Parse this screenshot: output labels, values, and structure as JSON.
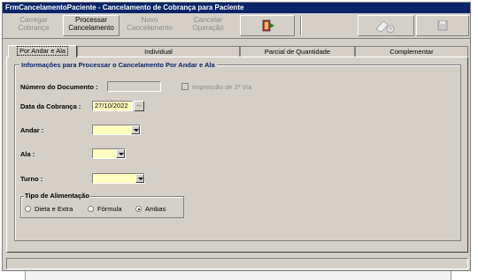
{
  "window": {
    "title": "FrmCancelamentoPaciente - Cancelamento de Cobrança para Paciente"
  },
  "toolbar": {
    "buttons": [
      {
        "line1": "Carregar",
        "line2": "Cobrança",
        "enabled": false
      },
      {
        "line1": "Processar",
        "line2": "Cancelamento",
        "enabled": true
      },
      {
        "line1": "Novo",
        "line2": "Cancelamento",
        "enabled": false
      },
      {
        "line1": "Cancelar",
        "line2": "Operação",
        "enabled": false
      }
    ],
    "icons": [
      "exit-door-icon",
      "help-icon",
      "save-disk-icon"
    ]
  },
  "tabs": [
    {
      "label": "Por Andar e Ala",
      "active": true
    },
    {
      "label": "Individual",
      "active": false
    },
    {
      "label": "Parcial de Quantidade",
      "active": false
    },
    {
      "label": "Complementar",
      "active": false
    }
  ],
  "form": {
    "group_title": "Informações para Processar o Cancelamento Por Andar e Ala",
    "documento_label": "Número do Documento :",
    "documento_value": "",
    "segunda_via_label": "Impressão de 2ª Via",
    "segunda_via_checked": false,
    "data_label": "Data da Cobrança :",
    "data_value": "27/10/2022",
    "data_button": "...",
    "andar_label": "Andar :",
    "andar_value": "",
    "ala_label": "Ala :",
    "ala_value": "",
    "turno_label": "Turno :",
    "turno_value": "",
    "alimentacao": {
      "title": "Tipo de Alimentação",
      "options": [
        "Dieta e Extra",
        "Fórmula",
        "Ambas"
      ],
      "selected": "Ambas"
    }
  },
  "colors": {
    "titlebar": "#0a246a",
    "face": "#d4d0c8",
    "required_field": "#ffffc0",
    "group_title": "#0a246a"
  }
}
